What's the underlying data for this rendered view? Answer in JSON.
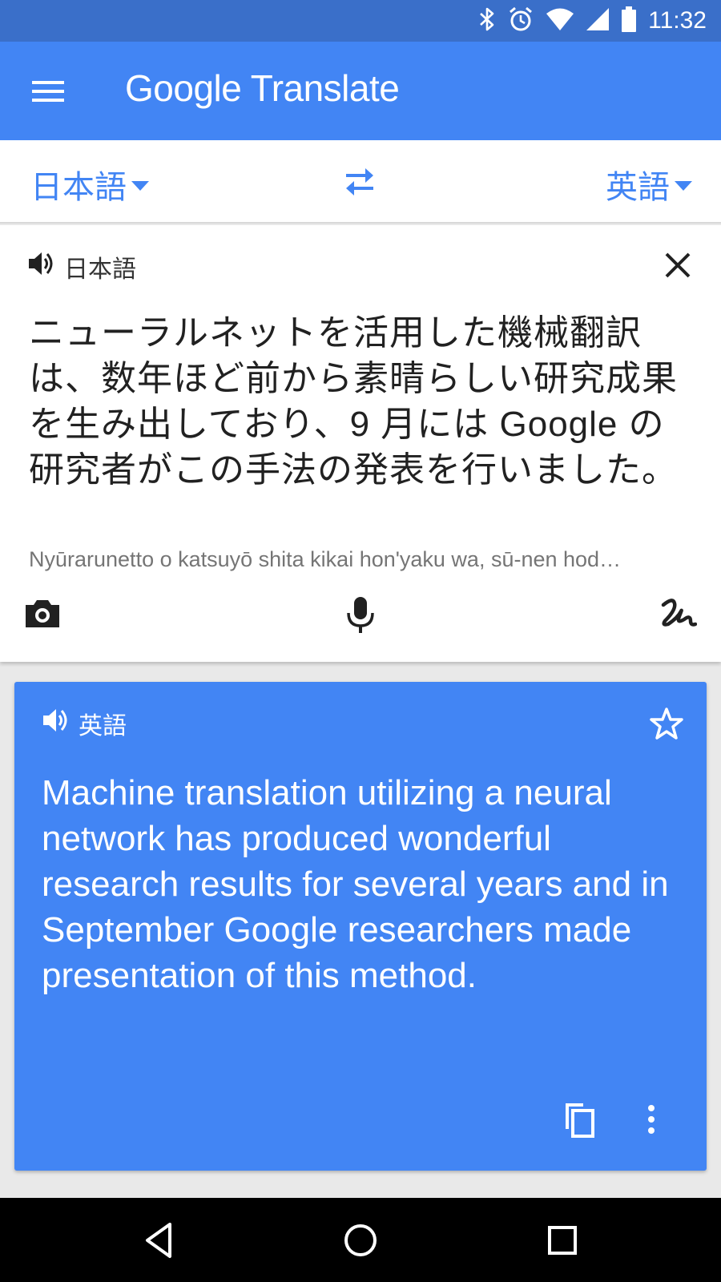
{
  "status": {
    "time": "11:32",
    "icons": [
      "bluetooth-icon",
      "alarm-icon",
      "wifi-icon",
      "signal-icon",
      "battery-icon"
    ]
  },
  "app": {
    "title_google": "Google",
    "title_translate": "Translate"
  },
  "languages": {
    "source": "日本語",
    "target": "英語"
  },
  "input": {
    "lang_label": "日本語",
    "text": "ニューラルネットを活用した機械翻訳は、数年ほど前から素晴らしい研究成果を生み出しており、9 月には Google の研究者がこの手法の発表を行いました。",
    "transliteration": "Nyūrarunetto o katsuyō shita kikai hon'yaku wa, sū-nen hod…"
  },
  "result": {
    "lang_label": "英語",
    "text": "Machine translation utilizing a neural network has produced wonderful research results for several years and in September Google researchers made presentation of this method."
  },
  "colors": {
    "primary": "#4285f4",
    "status_bar": "#3a6fc9",
    "background": "#e9e9e9"
  }
}
